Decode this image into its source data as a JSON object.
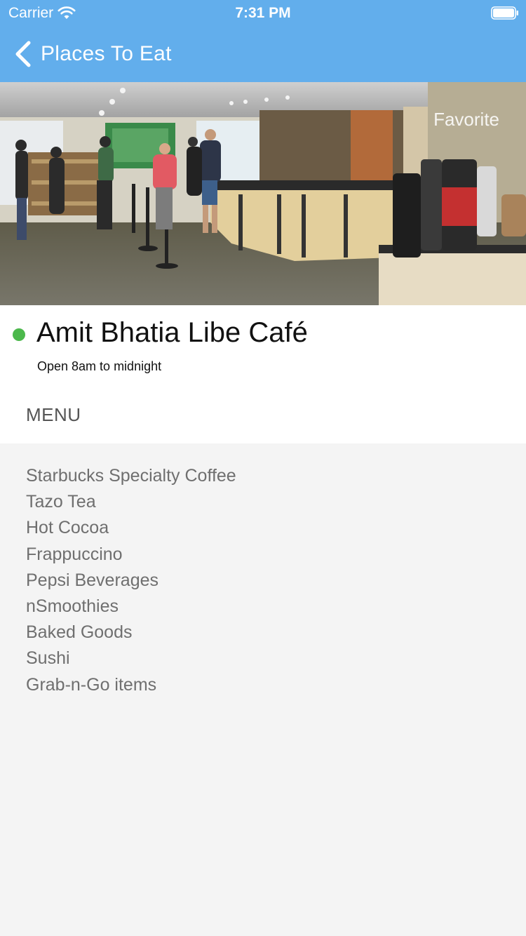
{
  "status_bar": {
    "carrier": "Carrier",
    "time": "7:31 PM",
    "icons": [
      "wifi-icon",
      "battery-icon"
    ]
  },
  "nav": {
    "back_label": "Places To Eat",
    "back_icon": "chevron-left-icon",
    "bar_color": "#62aeec"
  },
  "hero": {
    "favorite_label": "Favorite"
  },
  "place": {
    "name": "Amit Bhatia Libe Café",
    "hours": "Open 8am to midnight",
    "status_color": "#4cb84c"
  },
  "menu": {
    "heading": "MENU",
    "items": [
      "Starbucks Specialty Coffee",
      "Tazo Tea",
      "Hot Cocoa",
      "Frappuccino",
      "Pepsi Beverages",
      "nSmoothies",
      "Baked Goods",
      "Sushi",
      "Grab-n-Go items"
    ]
  }
}
